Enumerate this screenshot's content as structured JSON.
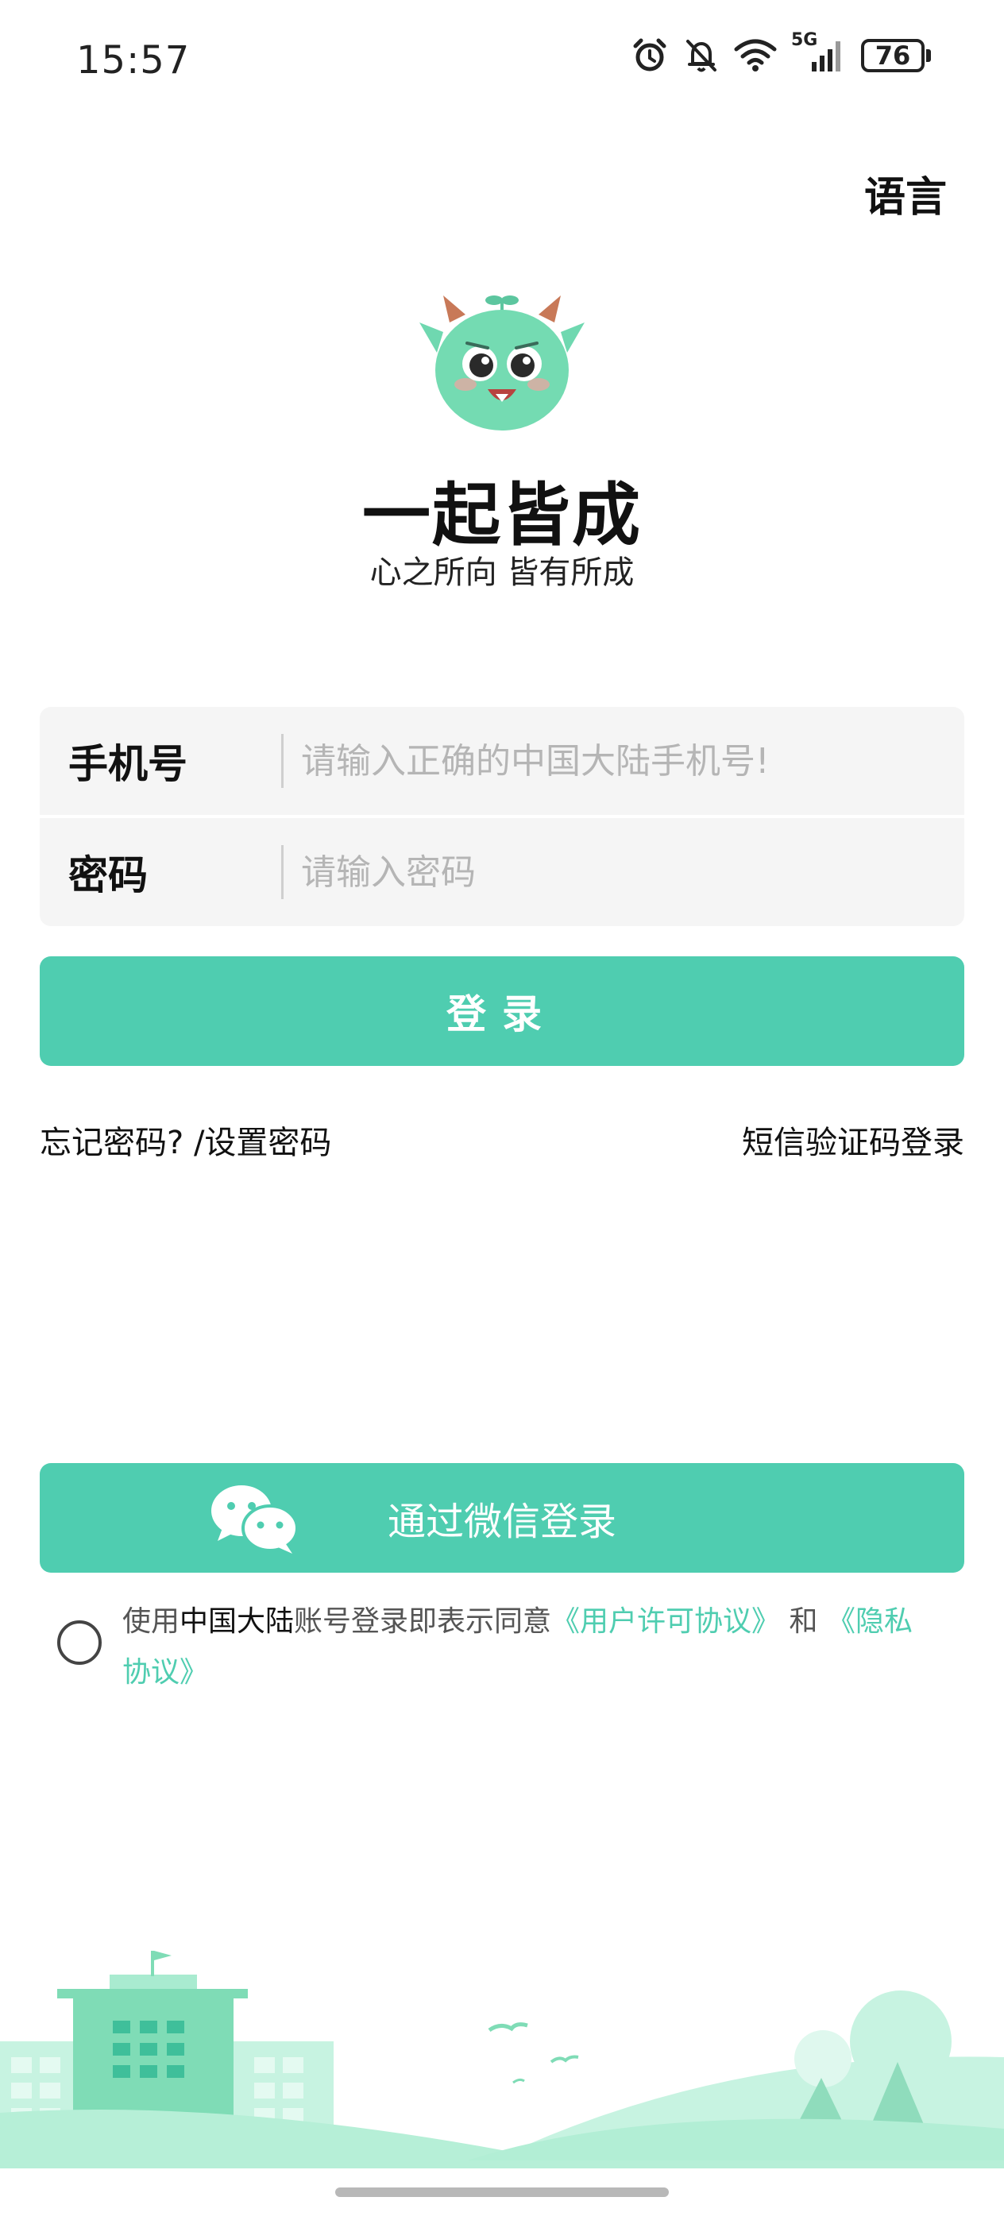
{
  "status_bar": {
    "time": "15:57",
    "network": "5G",
    "battery": "76",
    "icons": [
      "alarm-icon",
      "mute-bell-icon",
      "wifi-icon",
      "signal-icon",
      "battery-icon"
    ]
  },
  "header": {
    "language_label": "语言"
  },
  "brand": {
    "app_name": "一起皆成",
    "slogan": "心之所向 皆有所成",
    "mascot_icon": "green-dragon-mascot"
  },
  "login_form": {
    "phone_label": "手机号",
    "phone_placeholder": "请输入正确的中国大陆手机号!",
    "phone_value": "",
    "password_label": "密码",
    "password_placeholder": "请输入密码",
    "password_value": "",
    "login_button": "登录"
  },
  "links": {
    "forgot_password": "忘记密码? /设置密码",
    "sms_login": "短信验证码登录"
  },
  "wechat": {
    "button_label": "通过微信登录",
    "icon": "wechat-icon"
  },
  "agreement": {
    "checked": false,
    "prefix": "使用",
    "region": "中国大陆",
    "middle": "账号登录即表示同意",
    "user_agreement": "《用户许可协议》",
    "and": " 和 ",
    "privacy_policy": "《隐私协议》"
  },
  "colors": {
    "accent": "#4fcdb0",
    "input_bg": "#f5f5f5",
    "scenery_light": "#bdf2dc",
    "scenery_mid": "#7fdcb6"
  }
}
